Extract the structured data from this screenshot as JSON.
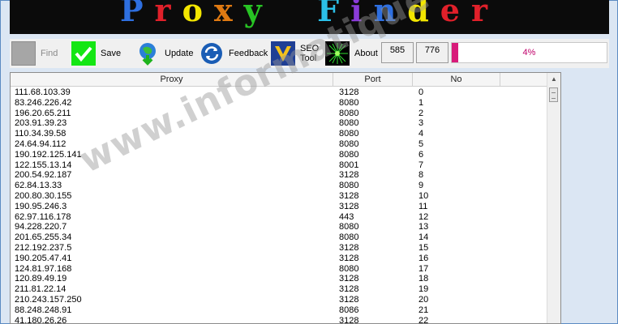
{
  "banner": {
    "title_letters": [
      "P",
      "r",
      "o",
      "x",
      "y",
      " ",
      " ",
      "F",
      "i",
      "n",
      "d",
      "e",
      "r"
    ],
    "title_colors": [
      "#2e6fe0",
      "#e0202a",
      "#f3e600",
      "#e07a12",
      "#28c424",
      "",
      "",
      "#2bc0e8",
      "#8a3bd8",
      "#2e6fe0",
      "#f3e600",
      "#e0202a",
      "#e0202a"
    ]
  },
  "toolbar": {
    "find_label": "Find",
    "save_label": "Save",
    "update_label": "Update",
    "feedback_label": "Feedback",
    "seo_label_1": "SEO",
    "seo_label_2": "Tool",
    "about_label": "About",
    "counter_1": "585",
    "counter_2": "776",
    "progress_text": "4%",
    "progress_value": 0.04,
    "accent_progress": "#d81b7a",
    "save_color": "#14e614"
  },
  "list": {
    "columns": [
      "Proxy",
      "Port",
      "No"
    ],
    "rows": [
      [
        "111.68.103.39",
        "3128",
        "0"
      ],
      [
        "83.246.226.42",
        "8080",
        "1"
      ],
      [
        "196.20.65.211",
        "8080",
        "2"
      ],
      [
        "203.91.39.23",
        "8080",
        "3"
      ],
      [
        "110.34.39.58",
        "8080",
        "4"
      ],
      [
        "24.64.94.112",
        "8080",
        "5"
      ],
      [
        "190.192.125.141",
        "8080",
        "6"
      ],
      [
        "122.155.13.14",
        "8001",
        "7"
      ],
      [
        "200.54.92.187",
        "3128",
        "8"
      ],
      [
        "62.84.13.33",
        "8080",
        "9"
      ],
      [
        "200.80.30.155",
        "3128",
        "10"
      ],
      [
        "190.95.246.3",
        "3128",
        "11"
      ],
      [
        "62.97.116.178",
        "443",
        "12"
      ],
      [
        "94.228.220.7",
        "8080",
        "13"
      ],
      [
        "201.65.255.34",
        "8080",
        "14"
      ],
      [
        "212.192.237.5",
        "3128",
        "15"
      ],
      [
        "190.205.47.41",
        "3128",
        "16"
      ],
      [
        "124.81.97.168",
        "8080",
        "17"
      ],
      [
        "120.89.49.19",
        "3128",
        "18"
      ],
      [
        "211.81.22.14",
        "3128",
        "19"
      ],
      [
        "210.243.157.250",
        "3128",
        "20"
      ],
      [
        "88.248.248.91",
        "8086",
        "21"
      ],
      [
        "41.180.26.26",
        "3128",
        "22"
      ]
    ]
  },
  "watermark": "www.informatique-mione.com"
}
